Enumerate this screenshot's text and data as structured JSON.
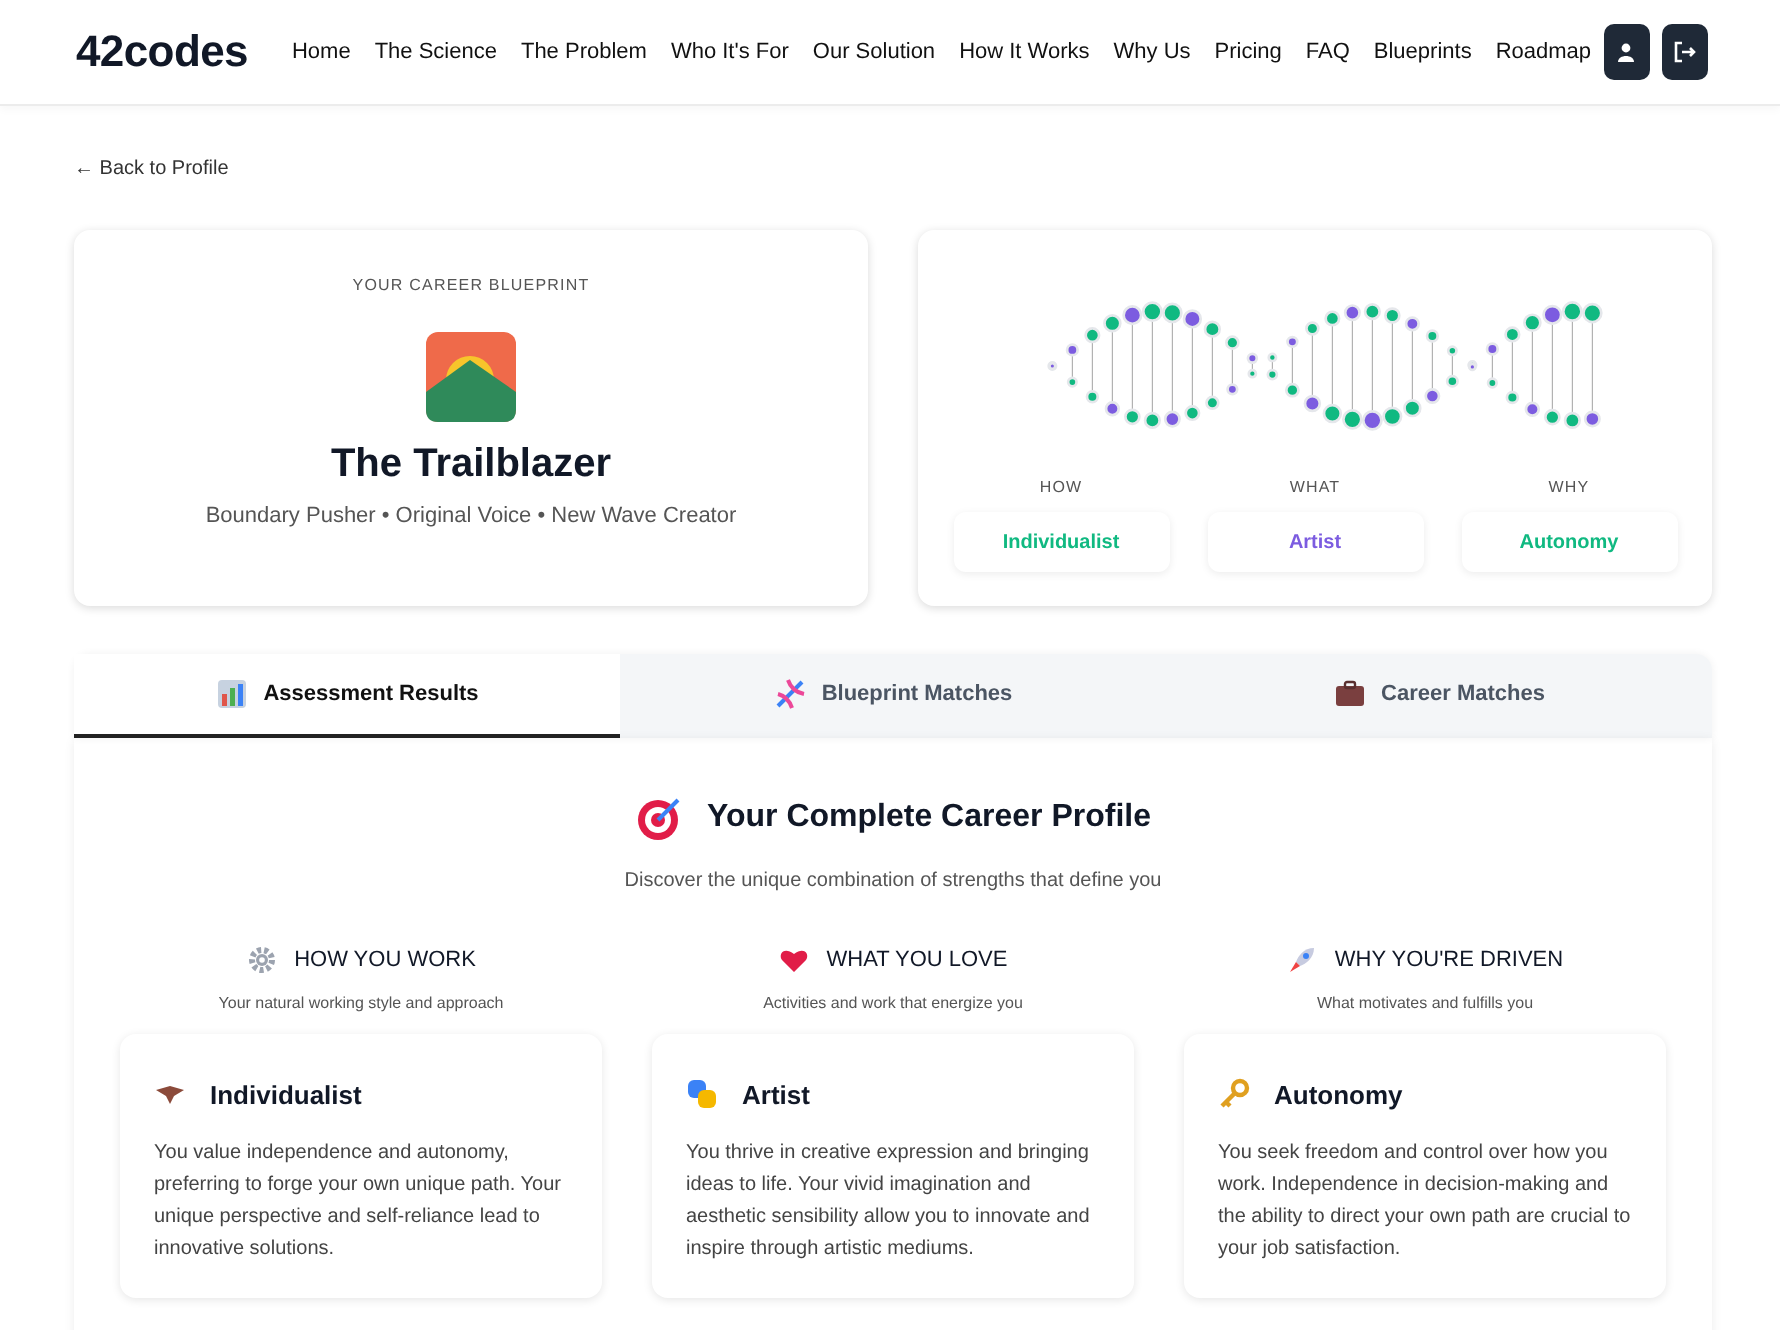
{
  "header": {
    "logo": "42codes",
    "nav": [
      "Home",
      "The Science",
      "The Problem",
      "Who It's For",
      "Our Solution",
      "How It Works",
      "Why Us",
      "Pricing",
      "FAQ",
      "Blueprints",
      "Roadmap"
    ]
  },
  "back_link": "← Back to Profile",
  "blueprint_card": {
    "eyebrow": "YOUR CAREER BLUEPRINT",
    "title": "The Trailblazer",
    "subtitle": "Boundary Pusher • Original Voice • New Wave Creator"
  },
  "dna_card": {
    "items": [
      {
        "label": "HOW",
        "value": "Individualist",
        "color": "#10b981"
      },
      {
        "label": "WHAT",
        "value": "Artist",
        "color": "#7c5ce0"
      },
      {
        "label": "WHY",
        "value": "Autonomy",
        "color": "#10b981"
      }
    ]
  },
  "tabs": [
    {
      "label": "Assessment Results",
      "selected": true
    },
    {
      "label": "Blueprint Matches",
      "selected": false
    },
    {
      "label": "Career Matches",
      "selected": false
    }
  ],
  "profile": {
    "title": "Your Complete Career Profile",
    "subtitle": "Discover the unique combination of strengths that define you",
    "columns": [
      {
        "heading": "HOW YOU WORK",
        "caption": "Your natural working style and approach",
        "card_title": "Individualist",
        "card_text": "You value independence and autonomy, preferring to forge your own unique path. Your unique perspective and self-reliance lead to innovative solutions."
      },
      {
        "heading": "WHAT YOU LOVE",
        "caption": "Activities and work that energize you",
        "card_title": "Artist",
        "card_text": "You thrive in creative expression and bringing ideas to life. Your vivid imagination and aesthetic sensibility allow you to innovate and inspire through artistic mediums."
      },
      {
        "heading": "WHY YOU'RE DRIVEN",
        "caption": "What motivates and fulfills you",
        "card_title": "Autonomy",
        "card_text": "You seek freedom and control over how you work. Independence in decision-making and the ability to direct your own path are crucial to your job satisfaction."
      }
    ]
  }
}
